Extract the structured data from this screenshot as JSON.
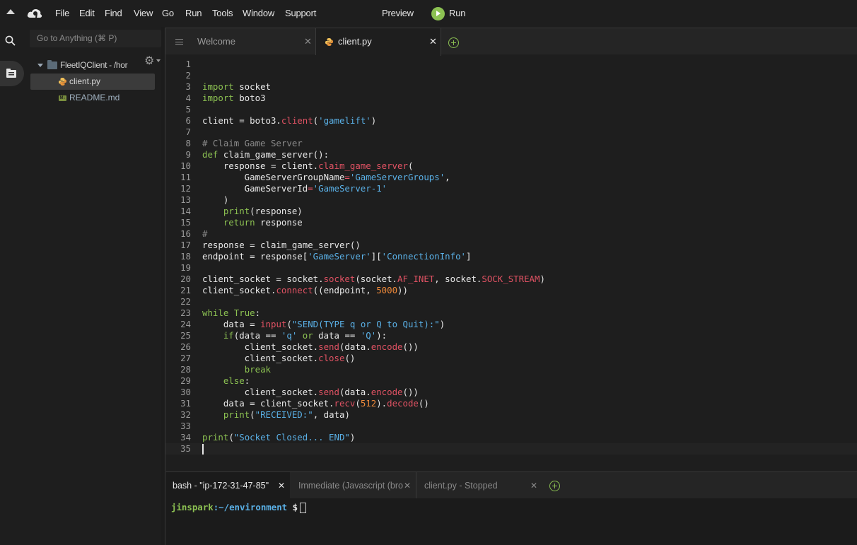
{
  "menubar": {
    "items": [
      "File",
      "Edit",
      "Find",
      "View",
      "Go",
      "Run",
      "Tools",
      "Window",
      "Support"
    ],
    "preview_label": "Preview",
    "run_label": "Run"
  },
  "sidebar": {
    "goto_placeholder": "Go to Anything (⌘ P)",
    "root_label": "FleetIQClient - /hor",
    "files": [
      "client.py",
      "README.md"
    ],
    "selected_file": "client.py"
  },
  "editor": {
    "tabs": [
      {
        "label": "Welcome",
        "active": false
      },
      {
        "label": "client.py",
        "active": true
      }
    ],
    "lines": [
      "",
      "",
      "import socket",
      "import boto3",
      "",
      "client = boto3.client('gamelift')",
      "",
      "# Claim Game Server",
      "def claim_game_server():",
      "    response = client.claim_game_server(",
      "        GameServerGroupName='GameServerGroups',",
      "        GameServerId='GameServer-1'",
      "    )",
      "    print(response)",
      "    return response",
      "#",
      "response = claim_game_server()",
      "endpoint = response['GameServer']['ConnectionInfo']",
      "",
      "client_socket = socket.socket(socket.AF_INET, socket.SOCK_STREAM)",
      "client_socket.connect((endpoint, 5000))",
      "",
      "while True:",
      "    data = input(\"SEND(TYPE q or Q to Quit):\")",
      "    if(data == 'q' or data == 'Q'):",
      "        client_socket.send(data.encode())",
      "        client_socket.close()",
      "        break",
      "    else:",
      "        client_socket.send(data.encode())",
      "    data = client_socket.recv(512).decode()",
      "    print(\"RECEIVED:\", data)",
      "",
      "print(\"Socket Closed... END\")",
      ""
    ]
  },
  "terminal": {
    "tabs": [
      {
        "label": "bash - \"ip-172-31-47-85\"",
        "active": true
      },
      {
        "label": "Immediate (Javascript (brow",
        "active": false
      },
      {
        "label": "client.py - Stopped",
        "active": false
      }
    ],
    "prompt_user": "jinspark",
    "prompt_path": ":~/environment",
    "prompt_symbol": " $"
  },
  "colors": {
    "accent_green": "#8cc152",
    "string_blue": "#5ab0e6",
    "function_red": "#e05263",
    "number_orange": "#f08a3a",
    "background": "#1e1e1e"
  }
}
